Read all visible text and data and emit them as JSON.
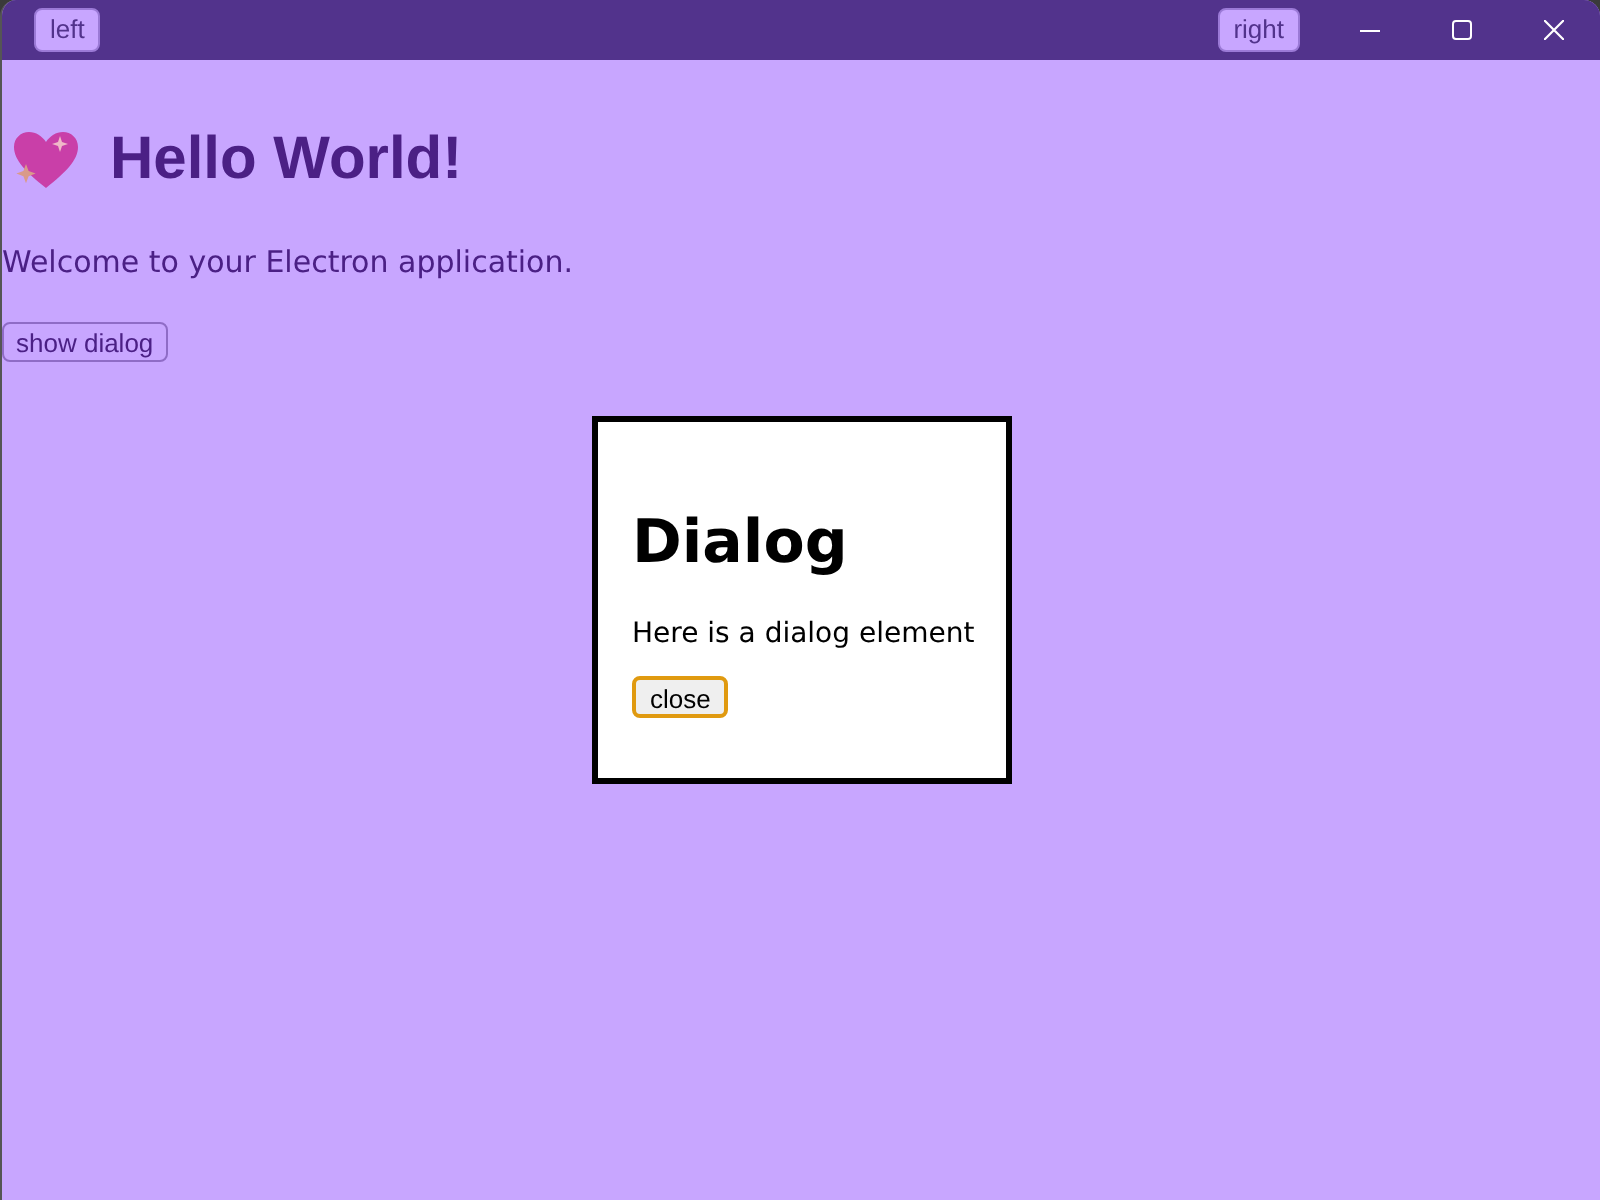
{
  "titlebar": {
    "left_button": "left",
    "right_button": "right"
  },
  "heading": "Hello World!",
  "intro": "Welcome to your Electron application.",
  "show_button": "show dialog",
  "dialog": {
    "title": "Dialog",
    "text": "Here is a dialog element",
    "close_button": {
      "label": "close",
      "focused": true
    }
  }
}
